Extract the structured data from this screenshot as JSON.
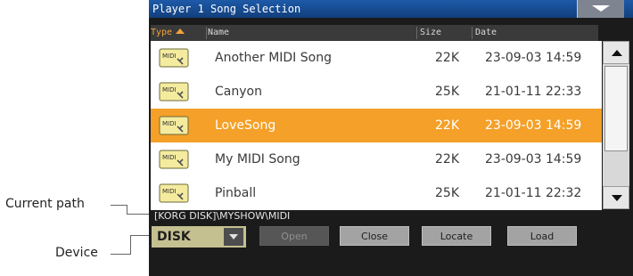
{
  "window": {
    "title": "Player 1 Song Selection"
  },
  "table": {
    "headers": {
      "type": "Type",
      "name": "Name",
      "size": "Size",
      "date": "Date"
    },
    "rows": [
      {
        "name": "Another MIDI Song",
        "size": "22K",
        "date": "23-09-03 14:59",
        "selected": false
      },
      {
        "name": "Canyon",
        "size": "25K",
        "date": "21-01-11 22:33",
        "selected": false
      },
      {
        "name": "LoveSong",
        "size": "22K",
        "date": "23-09-03 14:59",
        "selected": true
      },
      {
        "name": "My MIDI Song",
        "size": "22K",
        "date": "23-09-03 14:59",
        "selected": false
      },
      {
        "name": "Pinball",
        "size": "25K",
        "date": "21-01-11 22:32",
        "selected": false
      }
    ],
    "file_icon_label": "MIDI"
  },
  "path": "[KORG DISK]\\MYSHOW\\MIDI",
  "device": {
    "value": "DISK"
  },
  "buttons": {
    "open": "Open",
    "close": "Close",
    "locate": "Locate",
    "load": "Load"
  },
  "callouts": {
    "current_path": "Current path",
    "device": "Device"
  },
  "colors": {
    "accent": "#f5a028",
    "titlebar": "#1d5aa8",
    "device_bg": "#c5c090"
  }
}
